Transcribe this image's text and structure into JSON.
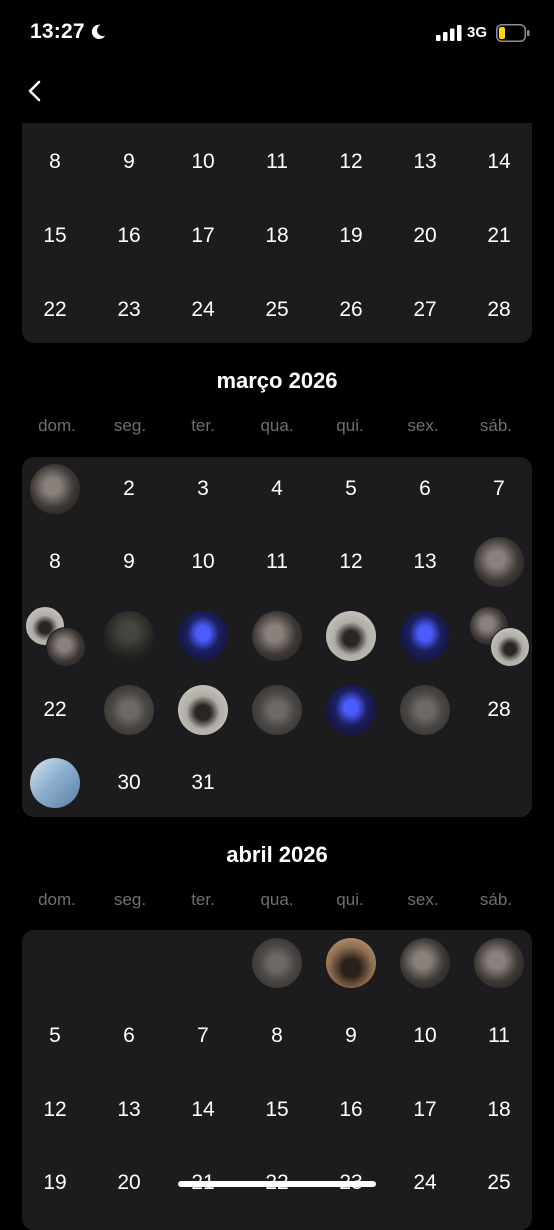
{
  "status_bar": {
    "time": "13:27",
    "network": "3G",
    "battery_color": "#ffd60a"
  },
  "navigation": {
    "back_icon": "chevron-left-icon"
  },
  "weekdays": [
    "dom.",
    "seg.",
    "ter.",
    "qua.",
    "qui.",
    "sex.",
    "sáb."
  ],
  "colors": {
    "background": "#000000",
    "card": "#1c1c1e",
    "weekday_text": "#6f6f73",
    "text": "#ffffff"
  },
  "months": {
    "february": {
      "rows": [
        [
          "8",
          "9",
          "10",
          "11",
          "12",
          "13",
          "14"
        ],
        [
          "15",
          "16",
          "17",
          "18",
          "19",
          "20",
          "21"
        ],
        [
          "22",
          "23",
          "24",
          "25",
          "26",
          "27",
          "28"
        ]
      ]
    },
    "march": {
      "title": "março 2026",
      "rows": [
        [
          "photo",
          "2",
          "3",
          "4",
          "5",
          "6",
          "7"
        ],
        [
          "8",
          "9",
          "10",
          "11",
          "12",
          "13",
          "photo"
        ],
        [
          "photo",
          "photo",
          "photo",
          "photo",
          "photo",
          "photo",
          "photo"
        ],
        [
          "22",
          "photo",
          "photo",
          "photo",
          "photo",
          "photo",
          "28"
        ],
        [
          "photo",
          "30",
          "31"
        ]
      ]
    },
    "april": {
      "title": "abril 2026",
      "rows": [
        [
          "",
          "",
          "",
          "photo",
          "photo",
          "photo",
          "photo"
        ],
        [
          "5",
          "6",
          "7",
          "8",
          "9",
          "10",
          "11"
        ],
        [
          "12",
          "13",
          "14",
          "15",
          "16",
          "17",
          "18"
        ],
        [
          "19",
          "20",
          "21",
          "22",
          "23",
          "24",
          "25"
        ]
      ]
    }
  }
}
